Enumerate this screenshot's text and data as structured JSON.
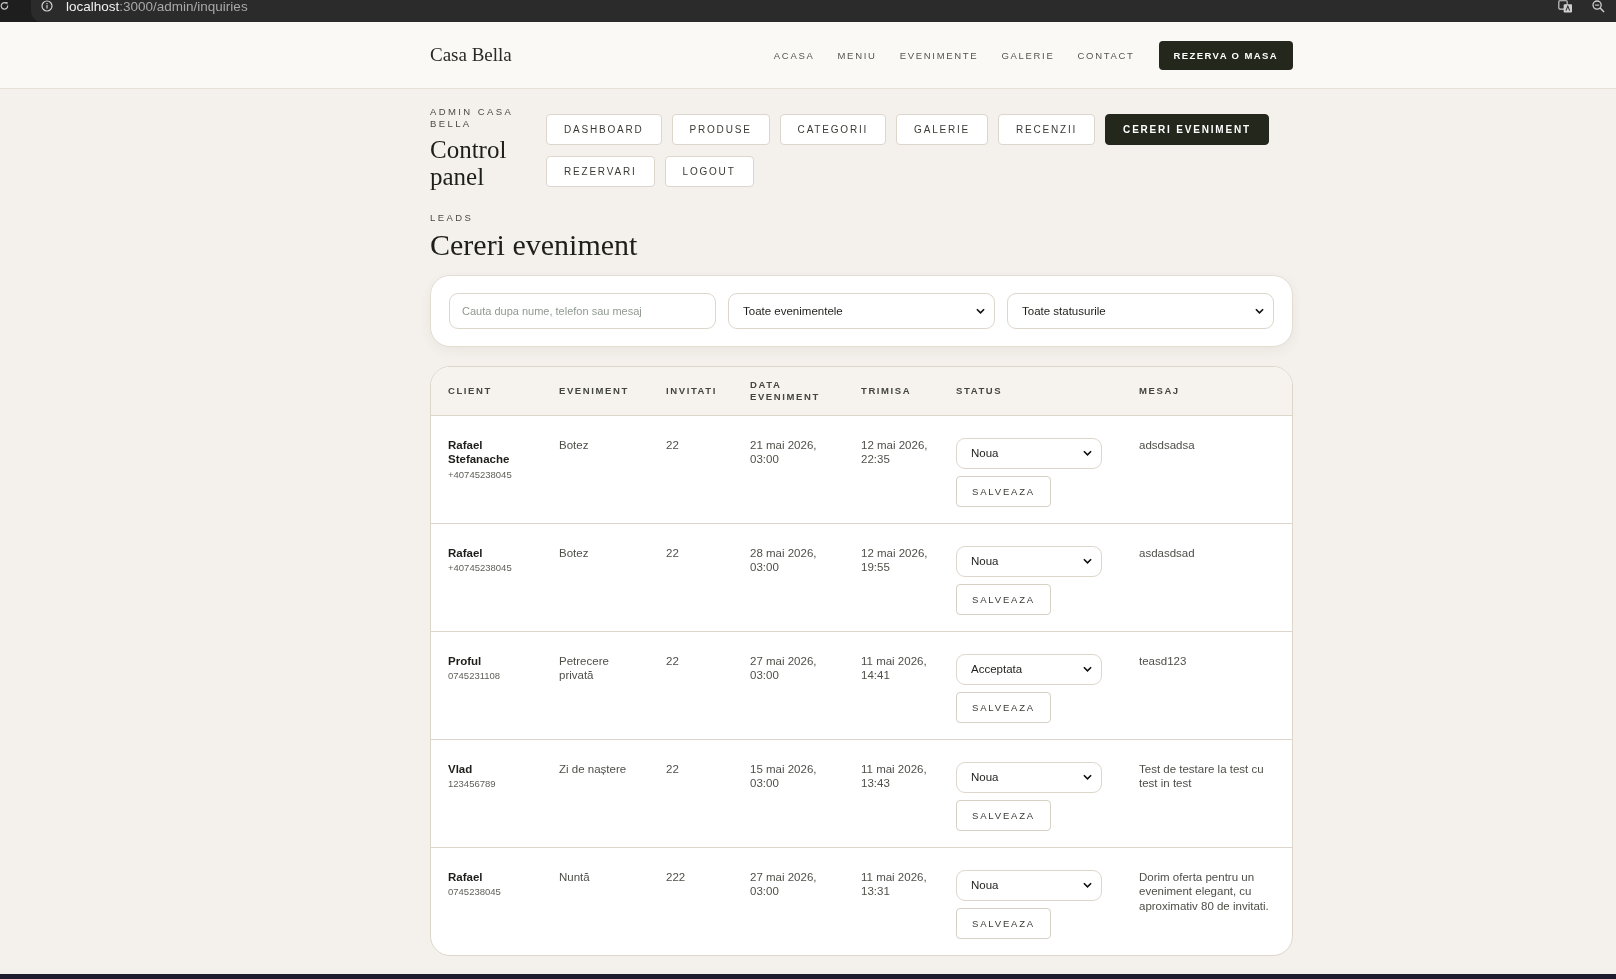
{
  "browser": {
    "address": {
      "host": "localhost",
      "path": ":3000/admin/inquiries"
    }
  },
  "site_header": {
    "logo": "Casa Bella",
    "nav": [
      "ACASA",
      "MENIU",
      "EVENIMENTE",
      "GALERIE",
      "CONTACT"
    ],
    "cta": "REZERVA O MASA"
  },
  "admin": {
    "eyebrow": "ADMIN CASA BELLA",
    "title": "Control panel",
    "tabs": [
      {
        "label": "DASHBOARD",
        "selected": false
      },
      {
        "label": "PRODUSE",
        "selected": false
      },
      {
        "label": "CATEGORII",
        "selected": false
      },
      {
        "label": "GALERIE",
        "selected": false
      },
      {
        "label": "RECENZII",
        "selected": false
      },
      {
        "label": "CERERI EVENIMENT",
        "selected": true
      },
      {
        "label": "REZERVARI",
        "selected": false
      },
      {
        "label": "LOGOUT",
        "selected": false
      }
    ]
  },
  "page": {
    "eyebrow": "LEADS",
    "title": "Cereri eveniment"
  },
  "filters": {
    "search": {
      "placeholder": "Cauta dupa nume, telefon sau mesaj"
    },
    "event_filter": {
      "value": "Toate evenimentele"
    },
    "status_filter": {
      "value": "Toate statusurile"
    }
  },
  "table": {
    "columns": [
      "CLIENT",
      "EVENIMENT",
      "INVITATI",
      "DATA EVENIMENT",
      "TRIMISA",
      "STATUS",
      "MESAJ"
    ],
    "rows": [
      {
        "client_name": "Rafael Stefanache",
        "client_phone": "+40745238045",
        "event": "Botez",
        "guests": "22",
        "event_date": "21 mai 2026, 03:00",
        "submitted": "12 mai 2026, 22:35",
        "status": "Noua",
        "save_label": "SALVEAZA",
        "message": "adsdsadsa"
      },
      {
        "client_name": "Rafael",
        "client_phone": "+40745238045",
        "event": "Botez",
        "guests": "22",
        "event_date": "28 mai 2026, 03:00",
        "submitted": "12 mai 2026, 19:55",
        "status": "Noua",
        "save_label": "SALVEAZA",
        "message": "asdasdsad"
      },
      {
        "client_name": "Proful",
        "client_phone": "0745231108",
        "event": "Petrecere privată",
        "guests": "22",
        "event_date": "27 mai 2026, 03:00",
        "submitted": "11 mai 2026, 14:41",
        "status": "Acceptata",
        "save_label": "SALVEAZA",
        "message": "teasd123"
      },
      {
        "client_name": "Vlad",
        "client_phone": "123456789",
        "event": "Zi de naștere",
        "guests": "22",
        "event_date": "15 mai 2026, 03:00",
        "submitted": "11 mai 2026, 13:43",
        "status": "Noua",
        "save_label": "SALVEAZA",
        "message": "Test de testare la test cu test in test"
      },
      {
        "client_name": "Rafael",
        "client_phone": "0745238045",
        "event": "Nuntă",
        "guests": "222",
        "event_date": "27 mai 2026, 03:00",
        "submitted": "11 mai 2026, 13:31",
        "status": "Noua",
        "save_label": "SALVEAZA",
        "message": "Dorim oferta pentru un eveniment elegant, cu aproximativ 80 de invitati."
      }
    ]
  }
}
